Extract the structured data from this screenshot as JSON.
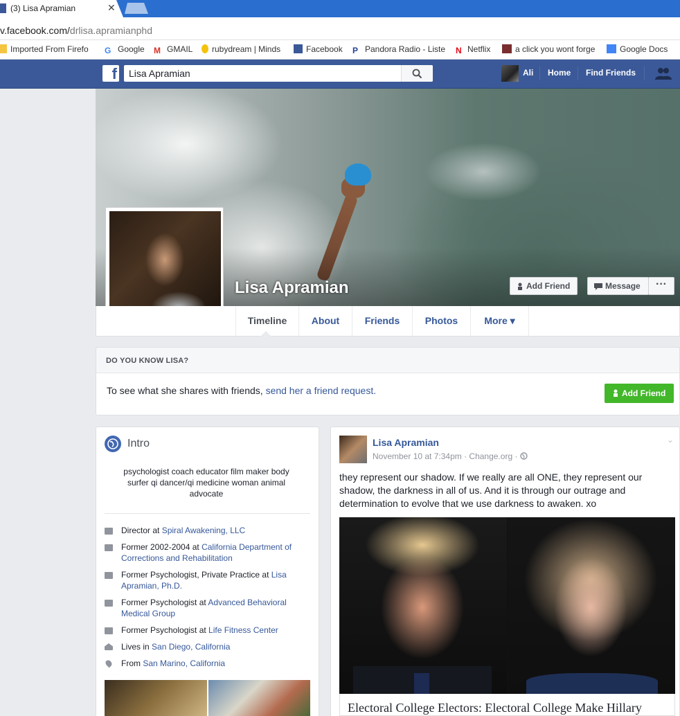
{
  "browser": {
    "tab_title": "(3) Lisa Apramian",
    "tab_close": "✕",
    "url_host": "v.facebook.com/",
    "url_path": "drlisa.apramianphd"
  },
  "bookmarks": [
    {
      "label": "Imported From Firefo",
      "color": "#f5c542"
    },
    {
      "label": "Google",
      "color": "#4285f4"
    },
    {
      "label": "GMAIL",
      "color": "#d93025"
    },
    {
      "label": "rubydream | Minds",
      "color": "#f4c20d"
    },
    {
      "label": "Facebook",
      "color": "#3b5998"
    },
    {
      "label": "Pandora Radio - Liste",
      "color": "#224099"
    },
    {
      "label": "Netflix",
      "color": "#e50914"
    },
    {
      "label": "a click you wont forge",
      "color": "#7a2e2e"
    },
    {
      "label": "Google Docs",
      "color": "#4285f4"
    }
  ],
  "fbbar": {
    "logo": "f",
    "search_value": "Lisa Apramian",
    "user": "Ali",
    "home": "Home",
    "find_friends": "Find Friends"
  },
  "profile": {
    "name": "Lisa Apramian",
    "add_friend": "Add Friend",
    "message": "Message",
    "more_dots": "···"
  },
  "tabs": [
    "Timeline",
    "About",
    "Friends",
    "Photos",
    "More ▾"
  ],
  "do_you_know": {
    "title": "DO YOU KNOW LISA?",
    "text": "To see what she shares with friends, ",
    "link": "send her a friend request.",
    "button": "Add Friend"
  },
  "intro": {
    "title": "Intro",
    "bio": "psychologist coach educator film maker body surfer qi dancer/qi medicine woman animal advocate",
    "rows": [
      {
        "prefix": "Director at ",
        "link": "Spiral Awakening, LLC"
      },
      {
        "prefix": "Former 2002-2004 at ",
        "link": "California Department of Corrections and Rehabilitation"
      },
      {
        "prefix": "Former Psychologist, Private Practice at ",
        "link": "Lisa Apramian, Ph.D."
      },
      {
        "prefix": "Former Psychologist at ",
        "link": "Advanced Behavioral Medical Group"
      },
      {
        "prefix": "Former Psychologist at ",
        "link": "Life Fitness Center"
      },
      {
        "prefix": "Lives in ",
        "link": "San Diego, California"
      },
      {
        "prefix": "From ",
        "link": "San Marino, California"
      }
    ]
  },
  "post": {
    "author": "Lisa Apramian",
    "meta": "November 10 at 7:34pm · Change.org · ",
    "chevron": "⌄",
    "text": "they represent our shadow. If we really are all ONE, they represent our shadow, the darkness in all of us. And it is through our outrage and determination to evolve that we use darkness to awaken. xo",
    "caption": "Electoral College Electors: Electoral College Make Hillary"
  }
}
